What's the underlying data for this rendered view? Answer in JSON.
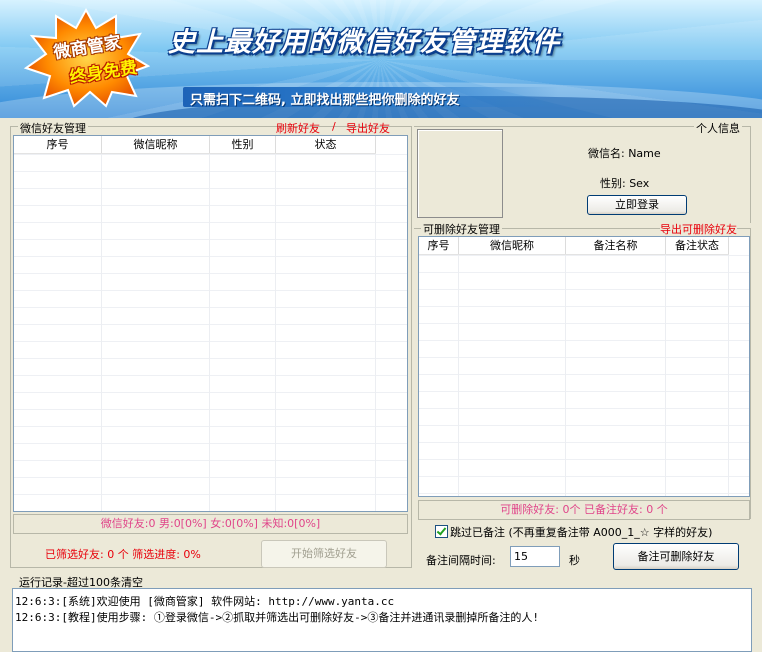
{
  "banner": {
    "badge_line1": "微商管家",
    "badge_line2": "终身免费",
    "slogan": "史上最好用的微信好友管理软件",
    "subline": "只需扫下二维码, 立即找出那些把你删除的好友"
  },
  "friends_panel": {
    "title": "微信好友管理",
    "refresh_link": "刷新好友",
    "separator": "/",
    "export_link": "导出好友",
    "columns": [
      "序号",
      "微信昵称",
      "性别",
      "状态"
    ],
    "rows": [],
    "stats": "微信好友:0   男:0[0%]   女:0[0%]   未知:0[0%]",
    "filtered_label": "已筛选好友: 0 个 筛选进度: 0%",
    "start_button": "开始筛选好友"
  },
  "profile": {
    "title": "个人信息",
    "wechat_name": "微信名: Name",
    "gender": "性别: Sex",
    "login_button": "立即登录"
  },
  "deletable_panel": {
    "title": "可删除好友管理",
    "export_link": "导出可删除好友",
    "columns": [
      "序号",
      "微信昵称",
      "备注名称",
      "备注状态"
    ],
    "rows": [],
    "stats": "可删除好友: 0个    已备注好友: 0 个",
    "skip_checkbox_label": "跳过已备注 (不再重复备注带 A000_1_☆ 字样的好友)",
    "skip_checked": true,
    "interval_label": "备注间隔时间:",
    "interval_value": "15",
    "interval_unit": "秒",
    "remark_button": "备注可删除好友"
  },
  "log": {
    "title": "运行记录-超过100条清空",
    "lines": [
      "12:6:3:[系统]欢迎使用 [微商管家]  软件网站: http://www.yanta.cc",
      "12:6:3:[教程]使用步骤: ①登录微信->②抓取并筛选出可删除好友->③备注并进通讯录删掉所备注的人!"
    ]
  },
  "colors": {
    "link_red": "#e8000b",
    "stats_pink": "#e0458a",
    "background": "#ece9d8"
  }
}
